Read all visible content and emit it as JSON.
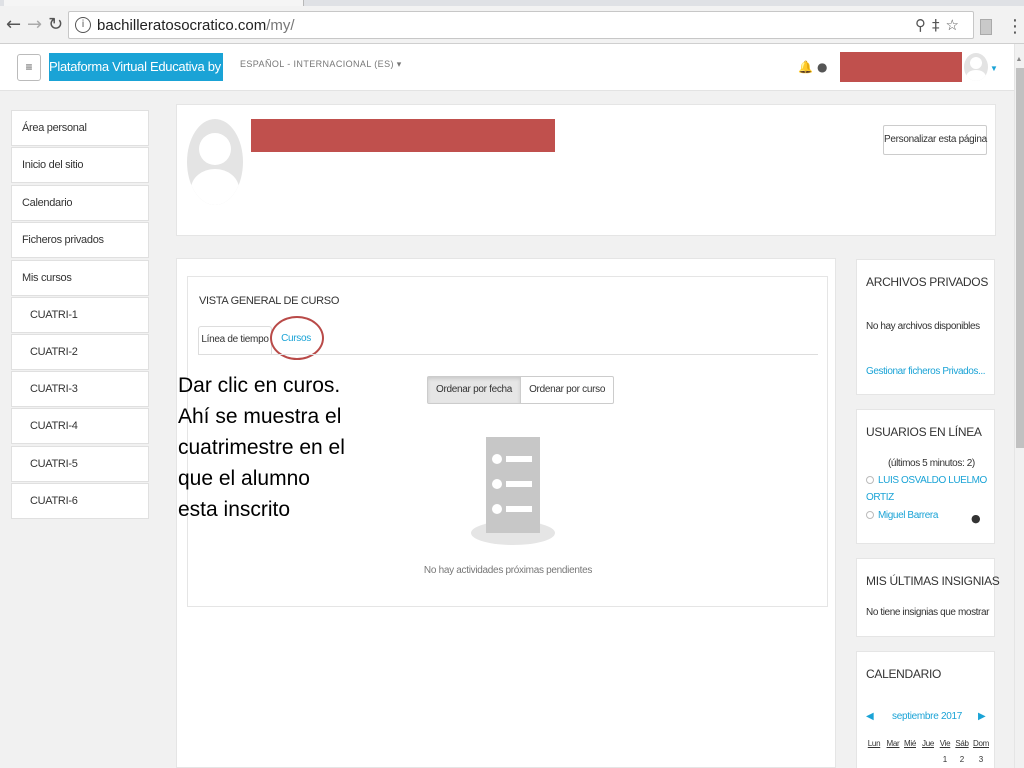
{
  "browser": {
    "url_host": "bachilleratosocratico.com",
    "url_path": "/my/"
  },
  "navbar": {
    "brand": "Plataforma Virtual Educativa by ILAT",
    "language": "ESPAÑOL - INTERNACIONAL (ES)",
    "redaction_color": "#c0504d"
  },
  "sidebar": {
    "items": [
      {
        "label": "Área personal"
      },
      {
        "label": "Inicio del sitio"
      },
      {
        "label": "Calendario"
      },
      {
        "label": "Ficheros privados"
      },
      {
        "label": "Mis cursos"
      },
      {
        "label": "CUATRI-1"
      },
      {
        "label": "CUATRI-2"
      },
      {
        "label": "CUATRI-3"
      },
      {
        "label": "CUATRI-4"
      },
      {
        "label": "CUATRI-5"
      },
      {
        "label": "CUATRI-6"
      }
    ]
  },
  "header": {
    "customize_label": "Personalizar esta página"
  },
  "overview": {
    "title": "VISTA GENERAL DE CURSO",
    "tabs": [
      "Línea de tiempo",
      "Cursos"
    ],
    "sort_by_date": "Ordenar por fecha",
    "sort_by_course": "Ordenar por curso",
    "empty_message": "No hay actividades próximas pendientes"
  },
  "annotation": {
    "lines": [
      "Dar clic en curos.",
      "Ahí se muestra el",
      "cuatrimestre en el",
      "que el alumno",
      "esta inscrito"
    ]
  },
  "blocks": {
    "private_files": {
      "title": "ARCHIVOS PRIVADOS",
      "empty": "No hay archivos disponibles",
      "manage_link": "Gestionar ficheros Privados..."
    },
    "online_users": {
      "title": "USUARIOS EN LÍNEA",
      "period": "(últimos 5 minutos: 2)",
      "users": [
        "LUIS OSVALDO LUELMO",
        "ORTIZ",
        "Miguel Barrera"
      ]
    },
    "badges": {
      "title": "MIS ÚLTIMAS INSIGNIAS",
      "empty": "No tiene insignias que mostrar"
    },
    "calendar": {
      "title": "CALENDARIO",
      "month": "septiembre 2017",
      "days": [
        "Lun",
        "Mar",
        "Mié",
        "Jue",
        "Vie",
        "Sáb",
        "Dom"
      ],
      "first_dates": [
        "1",
        "2",
        "3"
      ]
    }
  },
  "colors": {
    "accent": "#1aa3d6",
    "highlight_circle": "#b94a48",
    "page_bg": "#f1f1f1"
  },
  "icons": {
    "back": "arrow-left-icon",
    "forward": "arrow-right-icon",
    "reload": "reload-icon",
    "notifications": "bell-icon",
    "messages": "chat-icon",
    "zoom": "magnifier-icon",
    "bookmark": "star-icon"
  }
}
